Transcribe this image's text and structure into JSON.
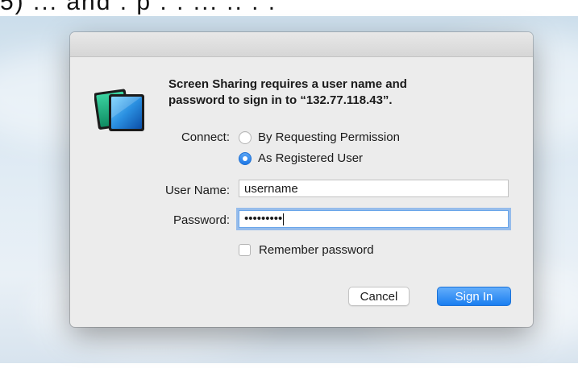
{
  "top_cropped_text": "5) ... and . p . . ...  .. . .",
  "dialog": {
    "app_icon": "screen-sharing-icon",
    "message_line1": "Screen Sharing requires a user name and",
    "message_line2": "password to sign in to “132.77.118.43”.",
    "connect_label": "Connect:",
    "options": [
      {
        "label": "By Requesting Permission",
        "selected": false
      },
      {
        "label": "As Registered User",
        "selected": true
      }
    ],
    "username_label": "User Name:",
    "username_value": "username",
    "password_label": "Password:",
    "password_value": "•••••••••",
    "remember_label": "Remember password",
    "remember_checked": false,
    "cancel_label": "Cancel",
    "signin_label": "Sign In"
  },
  "colors": {
    "accent": "#1a7ef0",
    "dialog_bg": "#ececec"
  }
}
